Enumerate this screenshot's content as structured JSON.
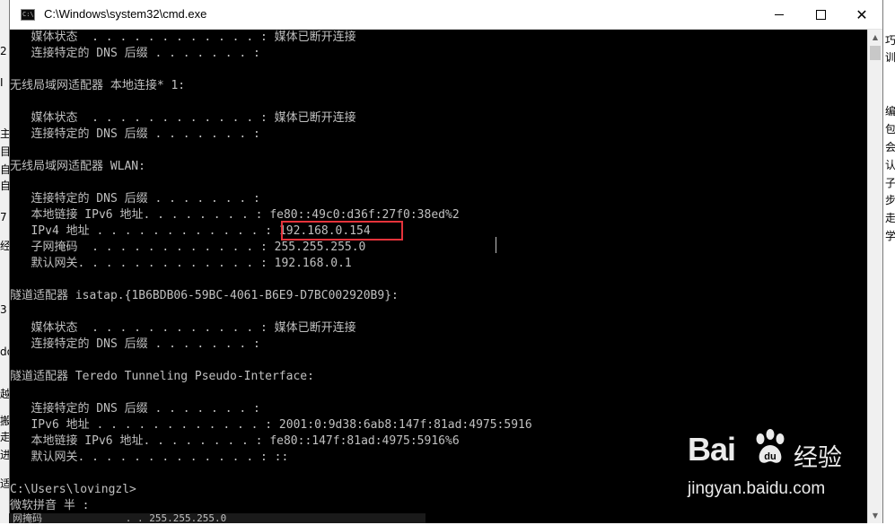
{
  "window": {
    "title": "C:\\Windows\\system32\\cmd.exe",
    "icon_text": "C:\\"
  },
  "console_lines": [
    "   媒体状态  . . . . . . . . . . . . : 媒体已断开连接",
    "   连接特定的 DNS 后缀 . . . . . . . :",
    "",
    "无线局域网适配器 本地连接* 1:",
    "",
    "   媒体状态  . . . . . . . . . . . . : 媒体已断开连接",
    "   连接特定的 DNS 后缀 . . . . . . . :",
    "",
    "无线局域网适配器 WLAN:",
    "",
    "   连接特定的 DNS 后缀 . . . . . . . :",
    "   本地链接 IPv6 地址. . . . . . . . : fe80::49c0:d36f:27f0:38ed%2",
    "   IPv4 地址 . . . . . . . . . . . . : 192.168.0.154",
    "   子网掩码  . . . . . . . . . . . . : 255.255.255.0",
    "   默认网关. . . . . . . . . . . . . : 192.168.0.1",
    "",
    "隧道适配器 isatap.{1B6BDB06-59BC-4061-B6E9-D7BC002920B9}:",
    "",
    "   媒体状态  . . . . . . . . . . . . : 媒体已断开连接",
    "   连接特定的 DNS 后缀 . . . . . . . :",
    "",
    "隧道适配器 Teredo Tunneling Pseudo-Interface:",
    "",
    "   连接特定的 DNS 后缀 . . . . . . . :",
    "   IPv6 地址 . . . . . . . . . . . . : 2001:0:9d38:6ab8:147f:81ad:4975:5916",
    "   本地链接 IPv6 地址. . . . . . . . : fe80::147f:81ad:4975:5916%6",
    "   默认网关. . . . . . . . . . . . . : ::",
    "",
    "C:\\Users\\lovingzl>",
    "微软拼音 半 :"
  ],
  "bottom_strip_text": "网掩码              . . 255.255.255.0",
  "right_side_fragments": [
    "巧",
    "训",
    "编",
    "包",
    "会",
    "认",
    "子",
    "步",
    "走",
    "学"
  ],
  "left_side_fragments": [
    "2",
    "I",
    "主",
    "目",
    "自",
    "自",
    "7",
    "经",
    "3",
    "do",
    "越",
    "搬",
    "走",
    "进",
    "适"
  ],
  "watermark": {
    "logo_text": "Bai",
    "logo_suffix": "经验",
    "url": "jingyan.baidu.com"
  },
  "colors": {
    "console_bg": "#000000",
    "console_fg": "#c0c0c0",
    "highlight": "#e5333b"
  }
}
